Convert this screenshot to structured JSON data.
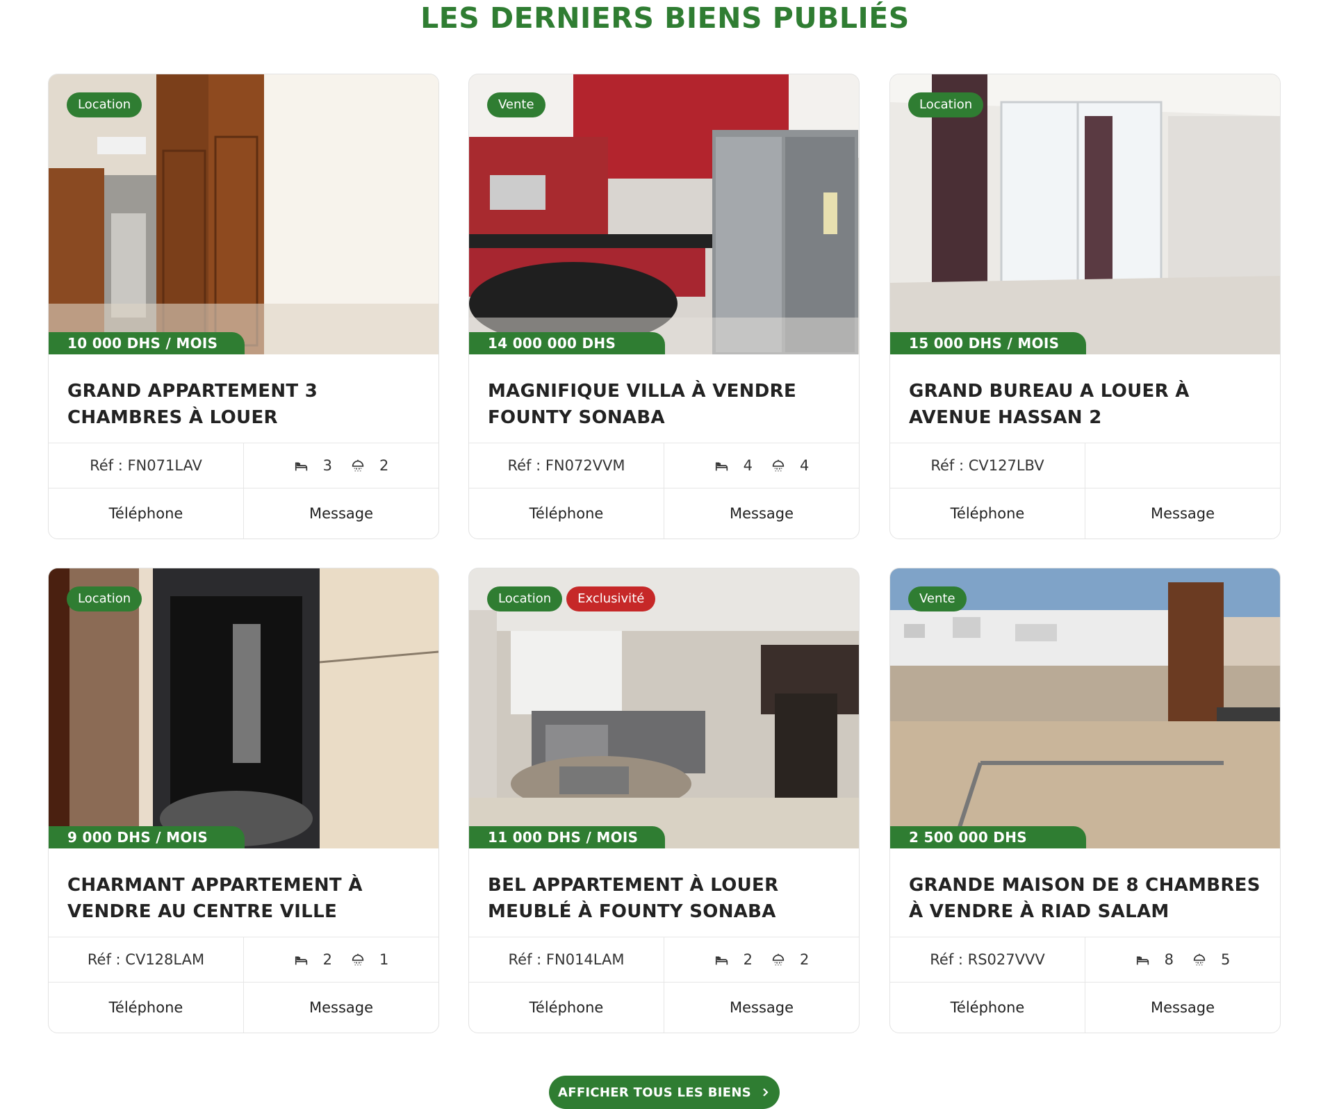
{
  "section": {
    "title": "LES DERNIERS BIENS PUBLIÉS"
  },
  "labels": {
    "phone": "Téléphone",
    "message": "Message"
  },
  "cta": {
    "label": "AFFICHER TOUS LES BIENS",
    "icon": "chevron-right-icon"
  },
  "icons": {
    "beds": "bed-icon",
    "baths": "shower-icon"
  },
  "colors": {
    "primary": "#2f7d32",
    "exclusive": "#c62828"
  },
  "properties": [
    {
      "tags": [
        "Location"
      ],
      "price": "10 000 DHS / MOIS",
      "title": "GRAND APPARTEMENT 3 CHAMBRES À LOUER",
      "ref": "Réf : FN071LAV",
      "beds": "3",
      "baths": "2",
      "photo": "apartment with wooden doors"
    },
    {
      "tags": [
        "Vente"
      ],
      "price": "14 000 000 DHS",
      "title": "MAGNIFIQUE VILLA À VENDRE FOUNTY SONABA",
      "ref": "Réf : FN072VVM",
      "beds": "4",
      "baths": "4",
      "photo": "red kitchen"
    },
    {
      "tags": [
        "Location"
      ],
      "price": "15 000 DHS / MOIS",
      "title": "GRAND BUREAU A LOUER À AVENUE HASSAN 2",
      "ref": "Réf : CV127LBV",
      "beds": "",
      "baths": "",
      "photo": "empty office with curtains"
    },
    {
      "tags": [
        "Location"
      ],
      "price": "9 000 DHS / MOIS",
      "title": "CHARMANT APPARTEMENT À VENDRE AU CENTRE VILLE",
      "ref": "Réf : CV128LAM",
      "beds": "2",
      "baths": "1",
      "photo": "shower cabin"
    },
    {
      "tags": [
        "Location",
        "Exclusivité"
      ],
      "price": "11 000 DHS / MOIS",
      "title": "BEL APPARTEMENT À LOUER MEUBLÉ À FOUNTY SONABA",
      "ref": "Réf : FN014LAM",
      "beds": "2",
      "baths": "2",
      "photo": "living room with grey sofa"
    },
    {
      "tags": [
        "Vente"
      ],
      "price": "2 500 000 DHS",
      "title": "GRANDE MAISON DE 8 CHAMBRES À VENDRE À RIAD SALAM",
      "ref": "Réf : RS027VVV",
      "beds": "8",
      "baths": "5",
      "photo": "rooftop terrace"
    }
  ]
}
